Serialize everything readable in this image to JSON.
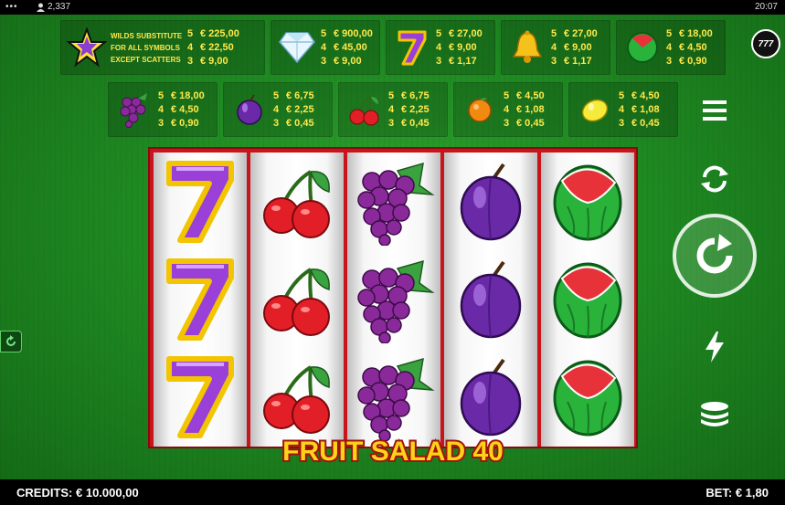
{
  "status_bar": {
    "players": "2,337",
    "time": "20:07"
  },
  "badge": {
    "text": "777"
  },
  "paytable": {
    "wild": {
      "icon": "star-icon",
      "text": [
        "WILDS SUBSTITUTE",
        "FOR ALL SYMBOLS",
        "EXCEPT SCATTERS"
      ],
      "pays": [
        [
          "5",
          "€ 225,00"
        ],
        [
          "4",
          "€ 22,50"
        ],
        [
          "3",
          "€ 9,00"
        ]
      ]
    },
    "symbols": [
      {
        "icon": "diamond-icon",
        "pays": [
          [
            "5",
            "€ 900,00"
          ],
          [
            "4",
            "€ 45,00"
          ],
          [
            "3",
            "€ 9,00"
          ]
        ]
      },
      {
        "icon": "seven-icon",
        "pays": [
          [
            "5",
            "€ 27,00"
          ],
          [
            "4",
            "€ 9,00"
          ],
          [
            "3",
            "€ 1,17"
          ]
        ]
      },
      {
        "icon": "bell-icon",
        "pays": [
          [
            "5",
            "€ 27,00"
          ],
          [
            "4",
            "€ 9,00"
          ],
          [
            "3",
            "€ 1,17"
          ]
        ]
      },
      {
        "icon": "watermelon-icon",
        "pays": [
          [
            "5",
            "€ 18,00"
          ],
          [
            "4",
            "€ 4,50"
          ],
          [
            "3",
            "€ 0,90"
          ]
        ]
      },
      {
        "icon": "grapes-icon",
        "pays": [
          [
            "5",
            "€ 18,00"
          ],
          [
            "4",
            "€ 4,50"
          ],
          [
            "3",
            "€ 0,90"
          ]
        ]
      },
      {
        "icon": "plum-icon",
        "pays": [
          [
            "5",
            "€ 6,75"
          ],
          [
            "4",
            "€ 2,25"
          ],
          [
            "3",
            "€ 0,45"
          ]
        ]
      },
      {
        "icon": "cherries-icon",
        "pays": [
          [
            "5",
            "€ 6,75"
          ],
          [
            "4",
            "€ 2,25"
          ],
          [
            "3",
            "€ 0,45"
          ]
        ]
      },
      {
        "icon": "orange-icon",
        "pays": [
          [
            "5",
            "€ 4,50"
          ],
          [
            "4",
            "€ 1,08"
          ],
          [
            "3",
            "€ 0,45"
          ]
        ]
      },
      {
        "icon": "lemon-icon",
        "pays": [
          [
            "5",
            "€ 4,50"
          ],
          [
            "4",
            "€ 1,08"
          ],
          [
            "3",
            "€ 0,45"
          ]
        ]
      }
    ]
  },
  "reels": [
    [
      "seven",
      "seven",
      "seven"
    ],
    [
      "cherries",
      "cherries",
      "cherries"
    ],
    [
      "grapes",
      "grapes",
      "grapes"
    ],
    [
      "plum",
      "plum",
      "plum"
    ],
    [
      "watermelon",
      "watermelon",
      "watermelon"
    ]
  ],
  "logo": {
    "text": "FRUIT SALAD 40"
  },
  "controls": [
    "menu-icon",
    "autoplay-icon",
    "spin-icon",
    "turbo-icon",
    "bet-coins-icon"
  ],
  "footer": {
    "credits": "CREDITS: € 10.000,00",
    "bet": "BET: € 1,80"
  },
  "colors": {
    "background": "#1f8a22",
    "reel_frame": "#c8141a",
    "paytable_text": "#ffe94a"
  }
}
